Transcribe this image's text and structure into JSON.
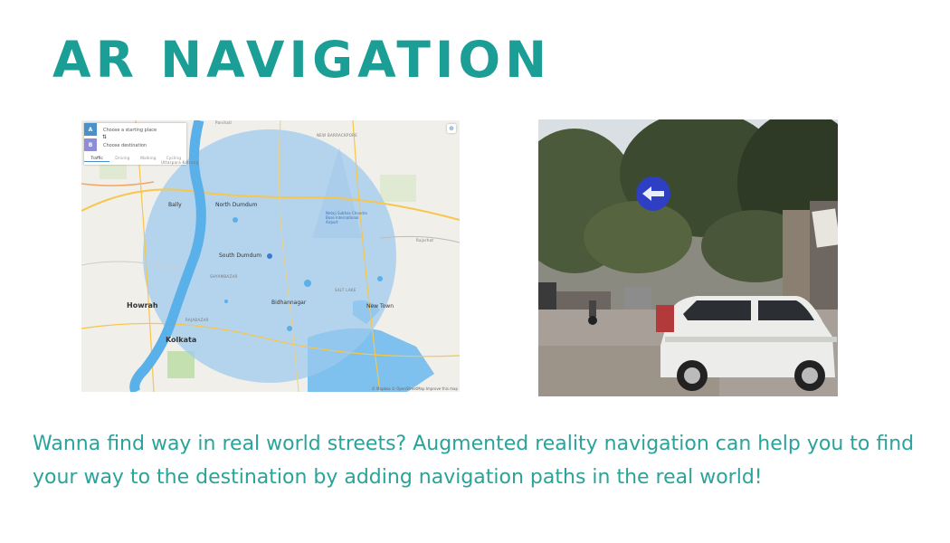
{
  "slide": {
    "title": "AR NAVIGATION",
    "description": "Wanna find way in real world streets? Augmented reality navigation can help you to find your way to the destination by adding navigation paths in the real world!"
  },
  "map": {
    "route_planner": {
      "start_pin": "A",
      "dest_pin": "B",
      "start_placeholder": "Choose a starting place",
      "dest_placeholder": "Choose destination",
      "modes": [
        "Traffic",
        "Driving",
        "Walking",
        "Cycling"
      ],
      "active_mode": "Traffic"
    },
    "labels": {
      "panihati": "Panihati",
      "new_barrackpore": "NEW BARRACKPORE",
      "bally": "Bally",
      "north_dumdum": "North Dumdum",
      "airport": "Netaji Subhas Chandra Bose International Airport",
      "south_dumdum": "South Dumdum",
      "howrah": "Howrah",
      "bidhannagar": "Bidhannagar",
      "new_town": "New Town",
      "kolkata": "Kolkata",
      "rajarhat": "Rajarhat",
      "uttarpara": "Uttarpara Kotrung",
      "salt_lake": "SALT LAKE",
      "shyambazar": "SHYAMBAZAR",
      "rajabazar": "RAJABAZAR"
    },
    "attribution": "© Mapbox © OpenStreetMap Improve this map",
    "colors": {
      "radius_fill": "#9cc9ef",
      "water": "#7ec0ee",
      "river": "#5ab0e8",
      "road": "#f7c64a",
      "pin_a": "#4a90c9",
      "pin_b": "#8e8ed6"
    }
  },
  "photo": {
    "sign_icon": "arrow-left-icon",
    "sign_color": "#2e3fc4"
  }
}
